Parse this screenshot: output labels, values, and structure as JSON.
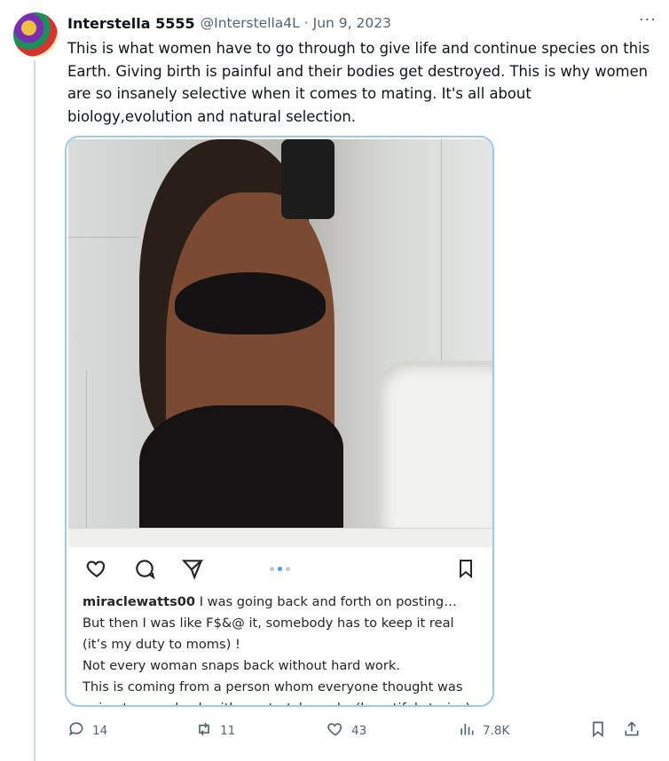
{
  "tweet": {
    "display_name": "Interstella 5555",
    "handle": "@Interstella4L",
    "separator": "·",
    "date": "Jun 9, 2023",
    "more_label": "···",
    "text": "This is what women have to go through to give life and continue species on this Earth. Giving birth is painful and their bodies get destroyed. This is why women are so insanely selective when it comes to mating. It's all about biology,evolution and natural selection."
  },
  "instagram_post": {
    "username": "miraclewatts00",
    "caption_lines": [
      "I was going back and forth on posting…",
      "But then I was like F$&@ it, somebody has to keep it real (it’s my duty to moms) !",
      "Not every woman snaps back without hard work.",
      "This is coming from a person whom everyone thought was going to snap back with no stretch marks (beautiful stories). I"
    ],
    "carousel": {
      "count": 3,
      "active_index": 1
    }
  },
  "actions": {
    "replies": "14",
    "retweets": "11",
    "likes": "43",
    "views": "7.8K"
  },
  "colors": {
    "accent": "#1d9bf0",
    "secondary_text": "#536471",
    "thread_line": "#cfd9de",
    "media_border": "#9cc9ee"
  },
  "icons": [
    "more-icon",
    "reply-icon",
    "retweet-icon",
    "like-icon",
    "views-icon",
    "bookmark-icon",
    "share-icon",
    "ig-heart-icon",
    "ig-comment-icon",
    "ig-send-icon",
    "ig-bookmark-icon"
  ]
}
